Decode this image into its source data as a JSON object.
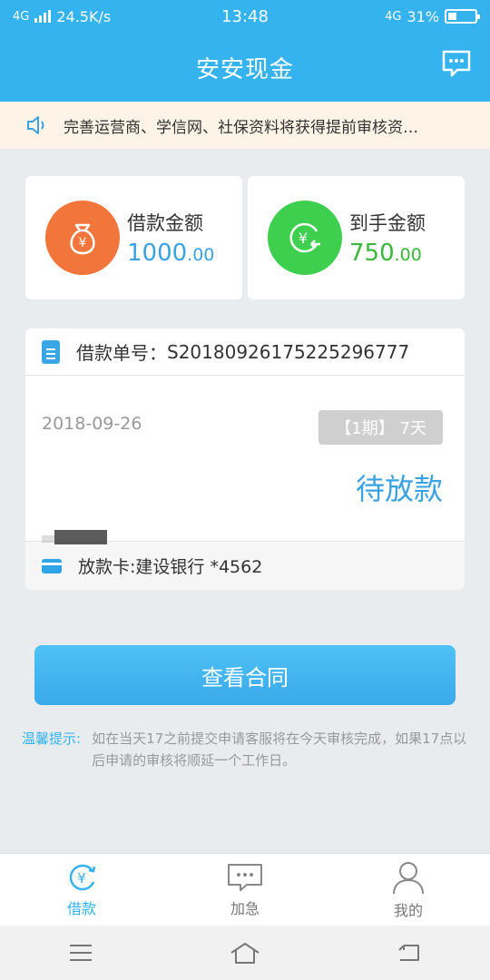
{
  "status_bar": {
    "network": "4G",
    "speed": "24.5K/s",
    "time": "13:48",
    "network_right": "4G",
    "battery": "31%"
  },
  "header": {
    "title": "安安现金"
  },
  "notice": {
    "text": "完善运营商、学信网、社保资料将获得提前审核资…"
  },
  "amounts": {
    "loan_label": "借款金额",
    "loan_int": "1000",
    "loan_dec": ".00",
    "received_label": "到手金额",
    "received_int": "750",
    "received_dec": ".00"
  },
  "order": {
    "number_label": "借款单号：",
    "number": "S2018092617522529677​7",
    "date": "2018-09-26",
    "period": "【1期】 7天",
    "status": "待放款",
    "card_label": "放款卡: ",
    "card_value": "建设银行 *4562"
  },
  "contract_button": "查看合同",
  "tip": {
    "label": "温馨提示:",
    "text": "如在当天17之前提交申请客服将在今天审核完成，如果17点以后申请的审核将顺延一个工作日。"
  },
  "tabs": [
    {
      "label": "借款",
      "icon": "loan-icon",
      "active": true
    },
    {
      "label": "加急",
      "icon": "chat-icon",
      "active": false
    },
    {
      "label": "我的",
      "icon": "person-icon",
      "active": false
    }
  ],
  "colors": {
    "primary": "#35b3ef",
    "orange": "#f2763b",
    "green": "#3fcf4f",
    "status": "#3aa2e0"
  }
}
